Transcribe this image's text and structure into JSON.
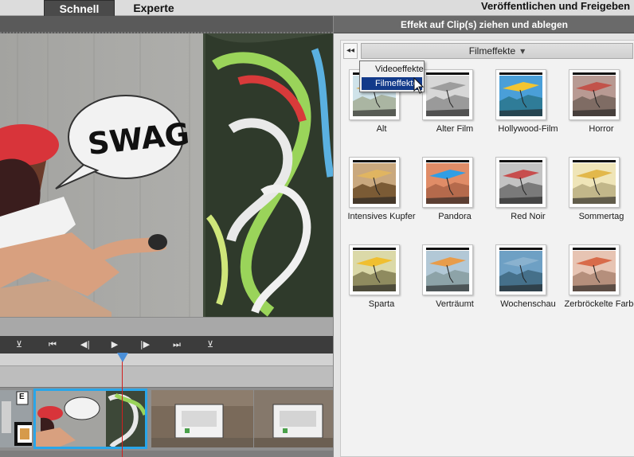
{
  "topbar": {
    "tabs": [
      {
        "label": "Schnell",
        "active": true
      },
      {
        "label": "Experte",
        "active": false
      }
    ],
    "publish_label": "Veröffentlichen und Freigeben"
  },
  "playback": {
    "controls": [
      {
        "name": "go-to-start",
        "glyph": "⊻"
      },
      {
        "name": "previous-edit",
        "glyph": "⏮"
      },
      {
        "name": "step-back",
        "glyph": "◀|"
      },
      {
        "name": "play",
        "glyph": "▶"
      },
      {
        "name": "step-forward",
        "glyph": "|▶"
      },
      {
        "name": "next-edit",
        "glyph": "⏭"
      },
      {
        "name": "go-to-end",
        "glyph": "⊻"
      }
    ]
  },
  "video": {
    "speech_bubble_text": "SWAG"
  },
  "timeline": {
    "clip1_badge": "E"
  },
  "effects_panel": {
    "header": "Effekt auf Clip(s) ziehen und ablegen",
    "collapse_glyph": "◂◂",
    "category": {
      "selected": "Filmeffekte",
      "options": [
        "Videoeffekte",
        "Filmeffekte"
      ],
      "highlighted": "Filmeffekte"
    },
    "effects": [
      {
        "label": "Alt",
        "sky": "#cfe3ea",
        "ground": "#aab5a2",
        "wing": "#d9a23c",
        "tint": "none"
      },
      {
        "label": "Alter Film",
        "sky": "#d7d7d7",
        "ground": "#9a9a9a",
        "wing": "#9d9d9d",
        "tint": "gray"
      },
      {
        "label": "Hollywood-Film",
        "sky": "#4a9fd8",
        "ground": "#2f7c98",
        "wing": "#f2c531",
        "tint": "vivid"
      },
      {
        "label": "Horror",
        "sky": "#b89a93",
        "ground": "#7f6c64",
        "wing": "#c2534a",
        "tint": "dark"
      },
      {
        "label": "Intensives Kupfer",
        "sky": "#c9a87e",
        "ground": "#7b5b35",
        "wing": "#e0b561",
        "tint": "sepia"
      },
      {
        "label": "Pandora",
        "sky": "#e08c67",
        "ground": "#b56a4c",
        "wing": "#2f9ee6",
        "tint": "orange"
      },
      {
        "label": "Red Noir",
        "sky": "#c3c3c3",
        "ground": "#7a7a7a",
        "wing": "#c74e4e",
        "tint": "noir"
      },
      {
        "label": "Sommertag",
        "sky": "#efe5b8",
        "ground": "#c2b78a",
        "wing": "#e2b84b",
        "tint": "warm"
      },
      {
        "label": "Sparta",
        "sky": "#dbd9a8",
        "ground": "#8f8b5f",
        "wing": "#f0bf30",
        "tint": "olive"
      },
      {
        "label": "Verträumt",
        "sky": "#b2c8d6",
        "ground": "#8da3a8",
        "wing": "#e89c4a",
        "tint": "soft"
      },
      {
        "label": "Wochenschau",
        "sky": "#6ea0c4",
        "ground": "#45708a",
        "wing": "#8ab2cf",
        "tint": "blue"
      },
      {
        "label": "Zerbröckelte Farbe",
        "sky": "#e7c4b3",
        "ground": "#b58f7c",
        "wing": "#d86b4a",
        "tint": "pink"
      }
    ]
  }
}
